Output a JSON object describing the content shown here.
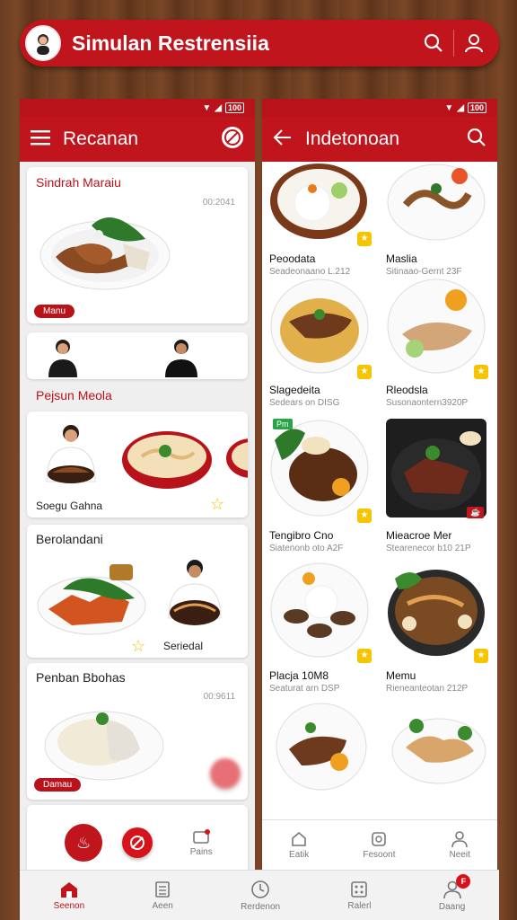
{
  "top_bar": {
    "title": "Simulan Restrensiia",
    "icons": [
      "chef-avatar",
      "search-icon",
      "user-icon"
    ],
    "accent": "#c0151c"
  },
  "status": {
    "battery": "100"
  },
  "left_panel": {
    "title": "Recanan",
    "card1": {
      "title": "Sindrah Maraiu",
      "meta": "00:2041",
      "pill": "Manu"
    },
    "section": "Pejsun Meola",
    "card2": {
      "label": "Soegu Gahna"
    },
    "card3": {
      "title": "Berolandani",
      "label": "Seriedal"
    },
    "card4": {
      "title": "Penban Bbohas",
      "meta": "00:9611",
      "pill": "Damau"
    },
    "bar": {
      "item2": "Pains"
    }
  },
  "right_panel": {
    "title": "Indetonoan",
    "items": [
      {
        "name": "Peoodata",
        "sub": "Seadeonaano L.212"
      },
      {
        "name": "Maslia",
        "sub": "Sitinaao-Gernt 23F"
      },
      {
        "name": "Slagedeita",
        "sub": "Sedears on DISG"
      },
      {
        "name": "Rleodsla",
        "sub": "Susonaontern3920P"
      },
      {
        "name": "Tengibro Cno",
        "sub": "Siatenonb oto A2F"
      },
      {
        "name": "Mieacroe Mer",
        "sub": "Stearenecor b10 21P"
      },
      {
        "name": "Placja 10M8",
        "sub": "Seaturat arn DSP"
      },
      {
        "name": "Memu",
        "sub": "Rieneanteotan 212P"
      }
    ],
    "bar": {
      "item1": "Eatik",
      "item2": "Fesoont",
      "item3": "Neeit"
    }
  },
  "bottom_nav": [
    {
      "label": "Seenon",
      "icon": "home-icon"
    },
    {
      "label": "Aeen",
      "icon": "list-icon"
    },
    {
      "label": "Rerdenon",
      "icon": "clock-icon"
    },
    {
      "label": "Ralerl",
      "icon": "grid-icon"
    },
    {
      "label": "Daang",
      "icon": "person-icon",
      "badge": "F"
    }
  ]
}
